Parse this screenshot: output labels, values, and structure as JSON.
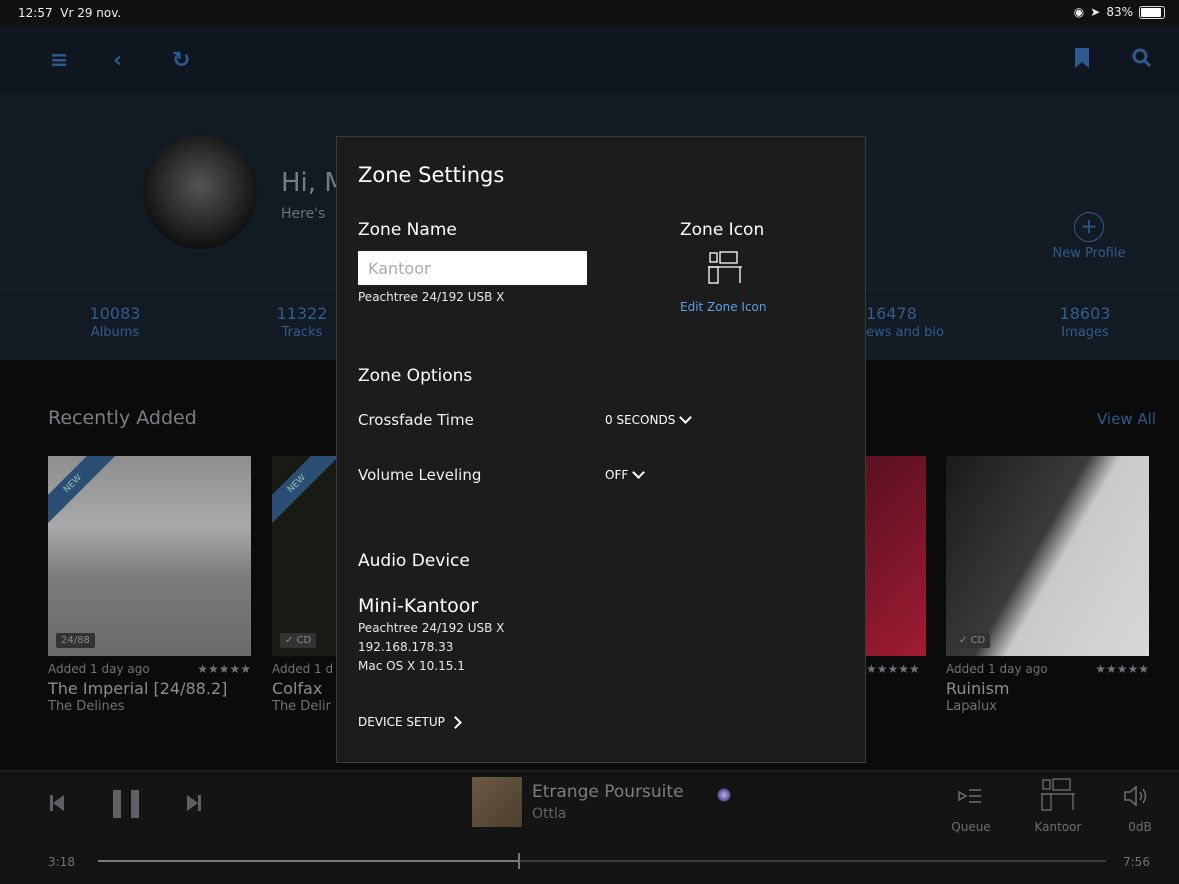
{
  "status_bar": {
    "time": "12:57",
    "date": "Vr 29 nov.",
    "battery": "83%"
  },
  "header": {
    "greeting": "Hi, M",
    "subtitle": "Here's",
    "new_profile": "New Profile"
  },
  "stats": [
    {
      "value": "10083",
      "label": "Albums"
    },
    {
      "value": "11322",
      "label": "Tracks"
    },
    {
      "value": "16478",
      "label": "ews and bio"
    },
    {
      "value": "18603",
      "label": "Images"
    }
  ],
  "recent": {
    "title": "Recently Added",
    "view_all": "View All",
    "albums": [
      {
        "added": "Added 1 day ago",
        "stars": "★★★★★",
        "title": "The Imperial [24/88.2]",
        "artist": "The Delines",
        "badge": "24/88",
        "ribbon": "NEW"
      },
      {
        "added": "Added 1 d",
        "stars": "",
        "title": "Colfax",
        "artist": "The Delir",
        "badge": "✓ CD",
        "ribbon": "NEW"
      },
      {
        "added": "",
        "stars": "★★★★★",
        "title": "",
        "artist": "",
        "badge": "",
        "ribbon": ""
      },
      {
        "added": "Added 1 day ago",
        "stars": "★★★★★",
        "title": "Ruinism",
        "artist": "Lapalux",
        "badge": "✓ CD",
        "ribbon": ""
      }
    ]
  },
  "dialog": {
    "title": "Zone Settings",
    "zone_name_label": "Zone Name",
    "zone_name_placeholder": "Kantoor",
    "zone_device": "Peachtree 24/192 USB X",
    "zone_icon_label": "Zone Icon",
    "edit_zone_icon": "Edit Zone Icon",
    "zone_options_label": "Zone Options",
    "crossfade_label": "Crossfade Time",
    "crossfade_value": "0 SECONDS",
    "volume_leveling_label": "Volume Leveling",
    "volume_leveling_value": "OFF",
    "audio_device_label": "Audio Device",
    "device_name": "Mini-Kantoor",
    "device_model": "Peachtree 24/192 USB X",
    "device_ip": "192.168.178.33",
    "device_os": "Mac OS X 10.15.1",
    "device_setup": "DEVICE SETUP"
  },
  "player": {
    "track": "Etrange Poursuite",
    "artist": "Ottla",
    "elapsed": "3:18",
    "duration": "7:56",
    "progress": 0.417,
    "queue_label": "Queue",
    "zone_label": "Kantoor",
    "volume_label": "0dB"
  }
}
